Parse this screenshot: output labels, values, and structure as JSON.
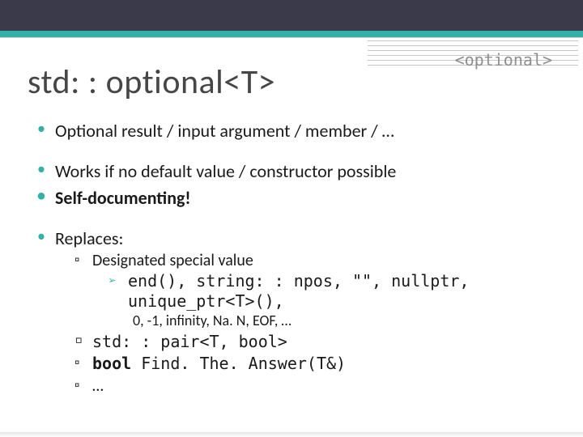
{
  "header": {
    "tag": "<optional>",
    "title": "std: : optional<T>"
  },
  "bullets": {
    "b1": "Optional result / input argument / member / …",
    "b2": "Works if no default value / constructor possible",
    "b3": "Self-documenting!",
    "b4": "Replaces:"
  },
  "replaces": {
    "r1_label": "Designated special value",
    "r1_code": "end(), string: : npos, \"\", nullptr, unique_ptr<T>(),",
    "r1_plain": "0, -1, infinity, Na. N, EOF, …",
    "r2": "std: : pair<T, bool>",
    "r3_a": "bool",
    "r3_b": " Find. The. Answer(T&)",
    "r4": "…"
  }
}
